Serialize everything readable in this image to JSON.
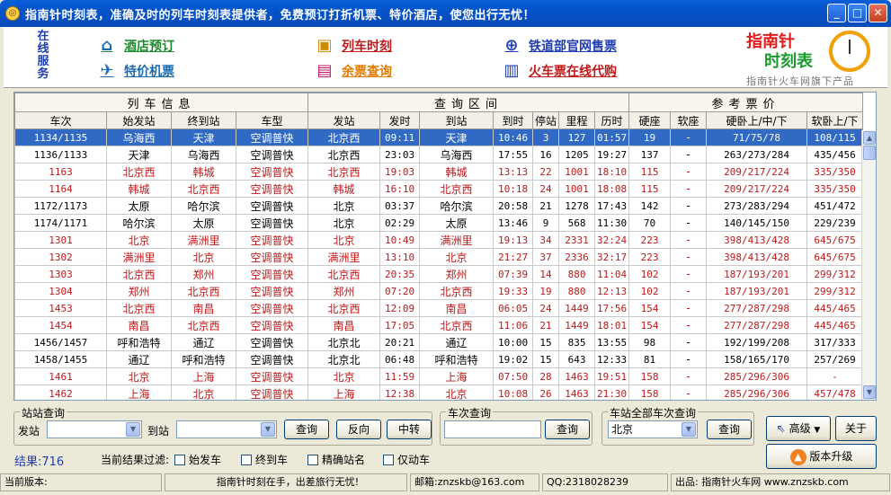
{
  "window": {
    "title": "指南针时刻表，准确及时的列车时刻表提供者，免费预订打折机票、特价酒店，使您出行无忧！",
    "min": "_",
    "max": "□",
    "close": "✕"
  },
  "banner": {
    "online_service": "在线服务",
    "links": [
      {
        "label": "酒店预订",
        "icon": "house-icon",
        "color": "#1a8a2a"
      },
      {
        "label": "特价机票",
        "icon": "airplane-icon",
        "color": "#1a6ab0"
      },
      {
        "label": "列车时刻",
        "icon": "train-icon",
        "color": "#c01818"
      },
      {
        "label": "余票查询",
        "icon": "ticket-box-icon",
        "color": "#e07a00"
      },
      {
        "label": "铁道部官网售票",
        "icon": "railway-logo-icon",
        "color": "#1e3db0"
      },
      {
        "label": "火车票在线代购",
        "icon": "ticket-icon",
        "color": "#c01818"
      }
    ],
    "logo_line1": "指南针",
    "logo_line2": "时刻表",
    "logo_sub": "指南针火车网旗下产品"
  },
  "table": {
    "groups": [
      "列车信息",
      "查询区间",
      "参考票价"
    ],
    "columns": [
      "车次",
      "始发站",
      "终到站",
      "车型",
      "发站",
      "发时",
      "到站",
      "到时",
      "停站",
      "里程",
      "历时",
      "硬座",
      "软座",
      "硬卧上/中/下",
      "软卧上/下"
    ],
    "rows": [
      {
        "hl": "sel",
        "c": [
          "1134/1135",
          "乌海西",
          "天津",
          "空调普快",
          "北京西",
          "09:11",
          "天津",
          "10:46",
          "3",
          "127",
          "01:57",
          "19",
          "-",
          "71/75/78",
          "108/115"
        ]
      },
      {
        "hl": "",
        "c": [
          "1136/1133",
          "天津",
          "乌海西",
          "空调普快",
          "北京西",
          "23:03",
          "乌海西",
          "17:55",
          "16",
          "1205",
          "19:27",
          "137",
          "-",
          "263/273/284",
          "435/456"
        ]
      },
      {
        "hl": "red",
        "c": [
          "1163",
          "北京西",
          "韩城",
          "空调普快",
          "北京西",
          "19:03",
          "韩城",
          "13:13",
          "22",
          "1001",
          "18:10",
          "115",
          "-",
          "209/217/224",
          "335/350"
        ]
      },
      {
        "hl": "red",
        "c": [
          "1164",
          "韩城",
          "北京西",
          "空调普快",
          "韩城",
          "16:10",
          "北京西",
          "10:18",
          "24",
          "1001",
          "18:08",
          "115",
          "-",
          "209/217/224",
          "335/350"
        ]
      },
      {
        "hl": "",
        "c": [
          "1172/1173",
          "太原",
          "哈尔滨",
          "空调普快",
          "北京",
          "03:37",
          "哈尔滨",
          "20:58",
          "21",
          "1278",
          "17:43",
          "142",
          "-",
          "273/283/294",
          "451/472"
        ]
      },
      {
        "hl": "",
        "c": [
          "1174/1171",
          "哈尔滨",
          "太原",
          "空调普快",
          "北京",
          "02:29",
          "太原",
          "13:46",
          "9",
          "568",
          "11:30",
          "70",
          "-",
          "140/145/150",
          "229/239"
        ]
      },
      {
        "hl": "red",
        "c": [
          "1301",
          "北京",
          "满洲里",
          "空调普快",
          "北京",
          "10:49",
          "满洲里",
          "19:13",
          "34",
          "2331",
          "32:24",
          "223",
          "-",
          "398/413/428",
          "645/675"
        ]
      },
      {
        "hl": "red",
        "c": [
          "1302",
          "满洲里",
          "北京",
          "空调普快",
          "满洲里",
          "13:10",
          "北京",
          "21:27",
          "37",
          "2336",
          "32:17",
          "223",
          "-",
          "398/413/428",
          "645/675"
        ]
      },
      {
        "hl": "red",
        "c": [
          "1303",
          "北京西",
          "郑州",
          "空调普快",
          "北京西",
          "20:35",
          "郑州",
          "07:39",
          "14",
          "880",
          "11:04",
          "102",
          "-",
          "187/193/201",
          "299/312"
        ]
      },
      {
        "hl": "red",
        "c": [
          "1304",
          "郑州",
          "北京西",
          "空调普快",
          "郑州",
          "07:20",
          "北京西",
          "19:33",
          "19",
          "880",
          "12:13",
          "102",
          "-",
          "187/193/201",
          "299/312"
        ]
      },
      {
        "hl": "red",
        "c": [
          "1453",
          "北京西",
          "南昌",
          "空调普快",
          "北京西",
          "12:09",
          "南昌",
          "06:05",
          "24",
          "1449",
          "17:56",
          "154",
          "-",
          "277/287/298",
          "445/465"
        ]
      },
      {
        "hl": "red",
        "c": [
          "1454",
          "南昌",
          "北京西",
          "空调普快",
          "南昌",
          "17:05",
          "北京西",
          "11:06",
          "21",
          "1449",
          "18:01",
          "154",
          "-",
          "277/287/298",
          "445/465"
        ]
      },
      {
        "hl": "",
        "c": [
          "1456/1457",
          "呼和浩特",
          "通辽",
          "空调普快",
          "北京北",
          "20:21",
          "通辽",
          "10:00",
          "15",
          "835",
          "13:55",
          "98",
          "-",
          "192/199/208",
          "317/333"
        ]
      },
      {
        "hl": "",
        "c": [
          "1458/1455",
          "通辽",
          "呼和浩特",
          "空调普快",
          "北京北",
          "06:48",
          "呼和浩特",
          "19:02",
          "15",
          "643",
          "12:33",
          "81",
          "-",
          "158/165/170",
          "257/269"
        ]
      },
      {
        "hl": "red",
        "c": [
          "1461",
          "北京",
          "上海",
          "空调普快",
          "北京",
          "11:59",
          "上海",
          "07:50",
          "28",
          "1463",
          "19:51",
          "158",
          "-",
          "285/296/306",
          "-"
        ]
      },
      {
        "hl": "red",
        "c": [
          "1462",
          "上海",
          "北京",
          "空调普快",
          "上海",
          "12:38",
          "北京",
          "10:08",
          "26",
          "1463",
          "21:30",
          "158",
          "-",
          "285/296/306",
          "457/478"
        ]
      }
    ]
  },
  "station_query": {
    "legend": "站站查询",
    "from_label": "发站",
    "to_label": "到站",
    "from_value": "",
    "to_value": "",
    "query": "查询",
    "reverse": "反向",
    "transfer": "中转"
  },
  "train_query": {
    "legend": "车次查询",
    "value": "",
    "query": "查询"
  },
  "station_all_query": {
    "legend": "车站全部车次查询",
    "value": "北京",
    "query": "查询"
  },
  "side_buttons": {
    "advanced": "高级",
    "about": "关于",
    "upgrade": "版本升级"
  },
  "result": {
    "label": "结果:",
    "count": "716"
  },
  "filter": {
    "label": "当前结果过滤:",
    "options": [
      "始发车",
      "终到车",
      "精确站名",
      "仅动车"
    ]
  },
  "status": {
    "version": "当前版本:",
    "slogan": "指南针时刻在手，出差旅行无忧!",
    "email": "邮箱:znzskb@163.com",
    "qq": "QQ:2318028239",
    "producer": "出品: 指南针火车网 www.znzskb.com"
  },
  "colors": {
    "red_row": "#c01818",
    "selected": "#316ac5",
    "title_blue": "#0453c9"
  }
}
